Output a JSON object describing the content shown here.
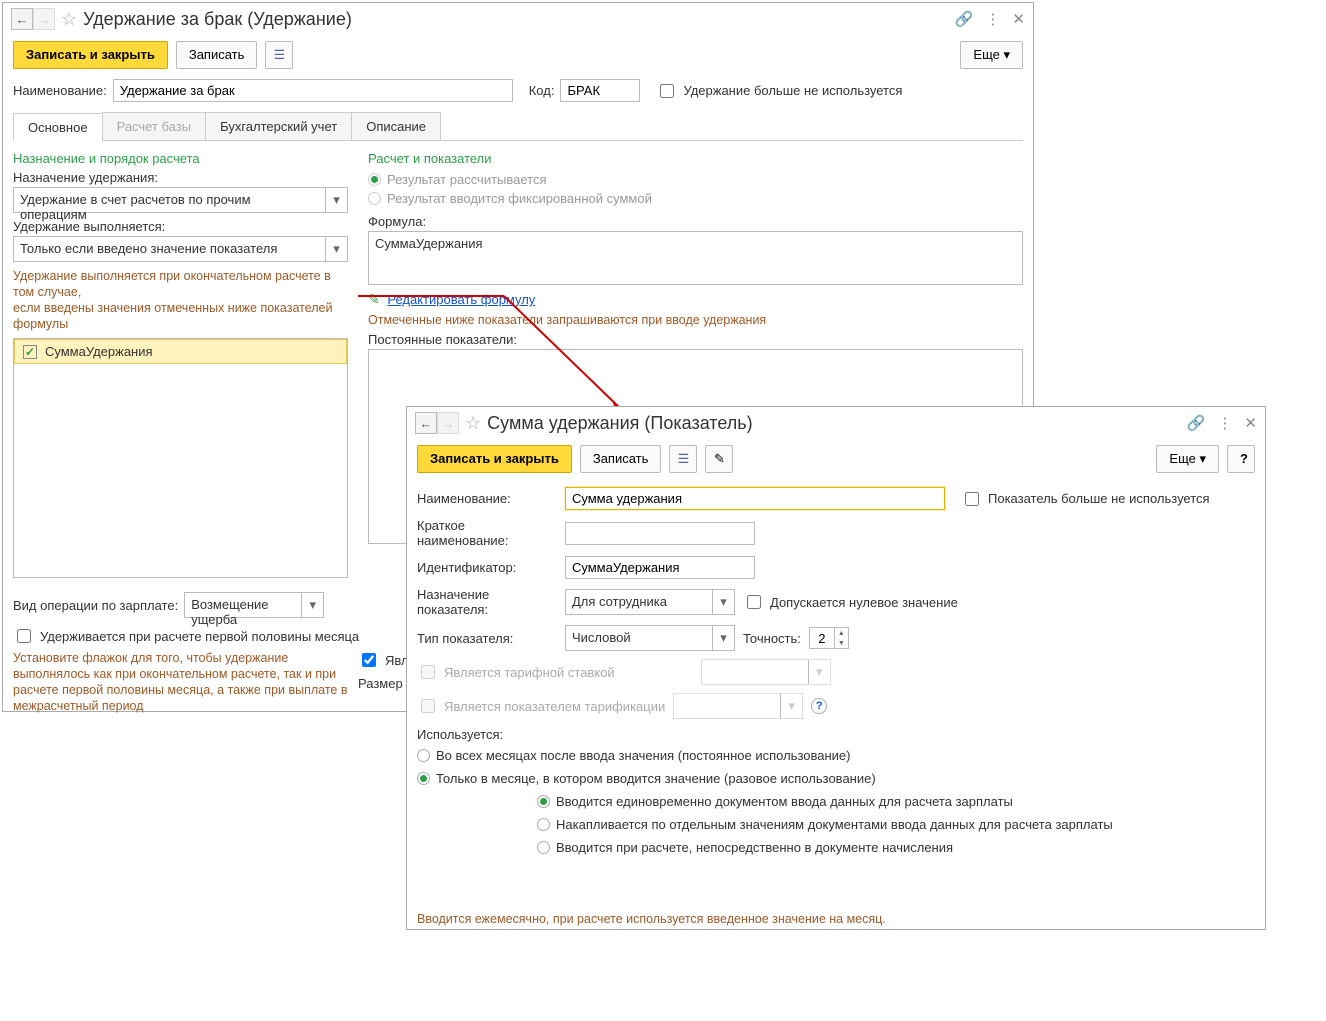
{
  "win1": {
    "title": "Удержание за брак (Удержание)",
    "toolbar": {
      "save_close": "Записать и закрыть",
      "save": "Записать",
      "more": "Еще"
    },
    "name_label": "Наименование:",
    "name_value": "Удержание за брак",
    "code_label": "Код:",
    "code_value": "БРАК",
    "not_used_label": "Удержание больше не используется",
    "tabs": [
      "Основное",
      "Расчет базы",
      "Бухгалтерский учет",
      "Описание"
    ],
    "left": {
      "section": "Назначение и порядок расчета",
      "purpose_label": "Назначение удержания:",
      "purpose_value": "Удержание в счет расчетов по прочим операциям",
      "perform_label": "Удержание выполняется:",
      "perform_value": "Только если введено значение показателя",
      "hint1": "Удержание выполняется при окончательном расчете в том случае,",
      "hint2": "если введены значения отмеченных ниже показателей формулы",
      "indicator": "СуммаУдержания",
      "op_label": "Вид операции по зарплате:",
      "op_value": "Возмещение ущерба",
      "first_half": "Удерживается при расчете первой половины месяца",
      "hint3": "Установите флажок для того, чтобы удержание выполнялось как при окончательном расчете, так и при расчете первой половины месяца, а также при выплате в межрасчетный период"
    },
    "right": {
      "section": "Расчет и показатели",
      "radio1": "Результат рассчитывается",
      "radio2": "Результат вводится фиксированной суммой",
      "formula_label": "Формула:",
      "formula_value": "СуммаУдержания",
      "edit_link": "Редактировать формулу",
      "hint": "Отмеченные ниже показатели запрашиваются при вводе удержания",
      "const_label": "Постоянные показатели:",
      "is_fine": "Являетс",
      "size": "Размер"
    }
  },
  "win2": {
    "title": "Сумма удержания (Показатель)",
    "toolbar": {
      "save_close": "Записать и закрыть",
      "save": "Записать",
      "more": "Еще",
      "help": "?"
    },
    "name_label": "Наименование:",
    "name_value": "Сумма удержания",
    "not_used": "Показатель больше не используется",
    "short_label": "Краткое наименование:",
    "short_value": "",
    "id_label": "Идентификатор:",
    "id_value": "СуммаУдержания",
    "purpose_label": "Назначение показателя:",
    "purpose_value": "Для сотрудника",
    "zero_ok": "Допускается нулевое значение",
    "type_label": "Тип показателя:",
    "type_value": "Числовой",
    "precision_label": "Точность:",
    "precision_value": "2",
    "tariff_rate": "Является тарифной ставкой",
    "tariff_ind": "Является показателем тарификации",
    "used_label": "Используется:",
    "radio_all": "Во всех месяцах после ввода значения (постоянное использование)",
    "radio_one": "Только в месяце, в котором вводится значение (разовое использование)",
    "sub1": "Вводится единовременно документом ввода данных для расчета зарплаты",
    "sub2": "Накапливается по отдельным значениям документами ввода данных для расчета зарплаты",
    "sub3": "Вводится при расчете, непосредственно в документе начисления",
    "bottom_hint": "Вводится ежемесячно, при расчете используется введенное значение на месяц."
  }
}
